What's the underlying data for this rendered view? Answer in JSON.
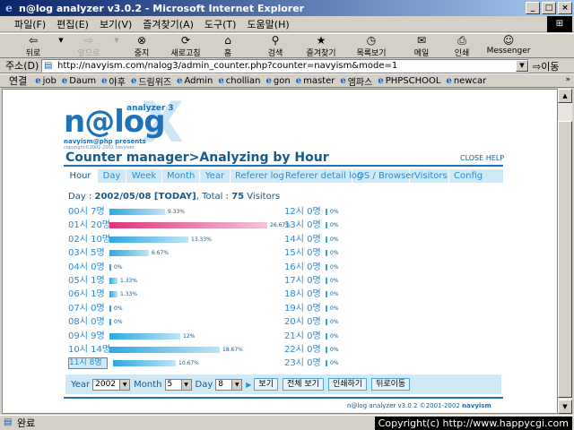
{
  "window": {
    "title": "n@log analyzer v3.0.2 - Microsoft Internet Explorer",
    "controls": {
      "minimize": "_",
      "maximize": "□",
      "close": "×"
    }
  },
  "menu": [
    "파일(F)",
    "편집(E)",
    "보기(V)",
    "즐겨찾기(A)",
    "도구(T)",
    "도움말(H)"
  ],
  "toolbar": {
    "back": "뒤로",
    "forward": "앞으로",
    "stop": "중지",
    "refresh": "새로고침",
    "home": "홈",
    "search": "검색",
    "favorites": "즐겨찾기",
    "history": "목록보기",
    "mail": "메일",
    "print": "인쇄",
    "messenger": "Messenger"
  },
  "address": {
    "label": "주소(D)",
    "url": "http://navyism.com/nalog3/admin_counter.php?counter=navyism&mode=1",
    "go": "이동"
  },
  "links": {
    "label": "연결",
    "items": [
      "job",
      "Daum",
      "야후",
      "드림위즈",
      "Admin",
      "chollian",
      "gon",
      "master",
      "엠파스",
      "PHPSCHOOL",
      "newcar"
    ]
  },
  "status": {
    "text": "완료",
    "copyright": "Copyright(c) http://www.happycgi.com"
  },
  "logo": {
    "word": "n@log",
    "analyzer": "analyzer 3",
    "tag1": "navyism@php presents",
    "tag2": "copyright©2001-2002 navyism"
  },
  "page": {
    "title": "Counter manager>Analyzing by Hour",
    "close_help": "CLOSE HELP",
    "tabs": [
      "Hour",
      "Day",
      "Week",
      "Month",
      "Year",
      "Referer log",
      "Referer detail log",
      "OS / Browser",
      "Visitors",
      "Config"
    ],
    "day_prefix": "Day : ",
    "date": "2002/05/08 [TODAY]",
    "total_prefix": ", Total : ",
    "total": "75",
    "total_suffix": " Visitors"
  },
  "hours": [
    {
      "label": "00시 7명",
      "pct": "9.33%",
      "value": 9.33
    },
    {
      "label": "01시 20명",
      "pct": "26.67%",
      "value": 26.67
    },
    {
      "label": "02시 10명",
      "pct": "13.33%",
      "value": 13.33
    },
    {
      "label": "03시 5명",
      "pct": "6.67%",
      "value": 6.67
    },
    {
      "label": "04시 0명",
      "pct": "0%",
      "value": 0
    },
    {
      "label": "05시 1명",
      "pct": "1.33%",
      "value": 1.33
    },
    {
      "label": "06시 1명",
      "pct": "1.33%",
      "value": 1.33
    },
    {
      "label": "07시 0명",
      "pct": "0%",
      "value": 0
    },
    {
      "label": "08시 0명",
      "pct": "0%",
      "value": 0
    },
    {
      "label": "09시 9명",
      "pct": "12%",
      "value": 12
    },
    {
      "label": "10시 14명",
      "pct": "18.67%",
      "value": 18.67
    },
    {
      "label": "11시 8명",
      "pct": "10.67%",
      "value": 10.67
    },
    {
      "label": "12시 0명",
      "pct": "0%",
      "value": 0
    },
    {
      "label": "13시 0명",
      "pct": "0%",
      "value": 0
    },
    {
      "label": "14시 0명",
      "pct": "0%",
      "value": 0
    },
    {
      "label": "15시 0명",
      "pct": "0%",
      "value": 0
    },
    {
      "label": "16시 0명",
      "pct": "0%",
      "value": 0
    },
    {
      "label": "17시 0명",
      "pct": "0%",
      "value": 0
    },
    {
      "label": "18시 0명",
      "pct": "0%",
      "value": 0
    },
    {
      "label": "19시 0명",
      "pct": "0%",
      "value": 0
    },
    {
      "label": "20시 0명",
      "pct": "0%",
      "value": 0
    },
    {
      "label": "21시 0명",
      "pct": "0%",
      "value": 0
    },
    {
      "label": "22시 0명",
      "pct": "0%",
      "value": 0
    },
    {
      "label": "23시 0명",
      "pct": "0%",
      "value": 0
    }
  ],
  "selected_hour": "11시 8명",
  "controls": {
    "year_label": "Year",
    "year": "2002",
    "month_label": "Month",
    "month": "5",
    "day_label": "Day",
    "day": "8",
    "view": "보기",
    "view_all": "전체 보기",
    "print": "인쇄하기",
    "back": "뒤로이동"
  },
  "footer": {
    "text": "n@log analyzer v3.0.2 ©2001-2002 ",
    "author": "navyism"
  },
  "colors": {
    "accent": "#1d72b8",
    "bar": "#2ea8e0",
    "max_bar": "#d8377b",
    "tab_bg": "#cfe9f6"
  }
}
